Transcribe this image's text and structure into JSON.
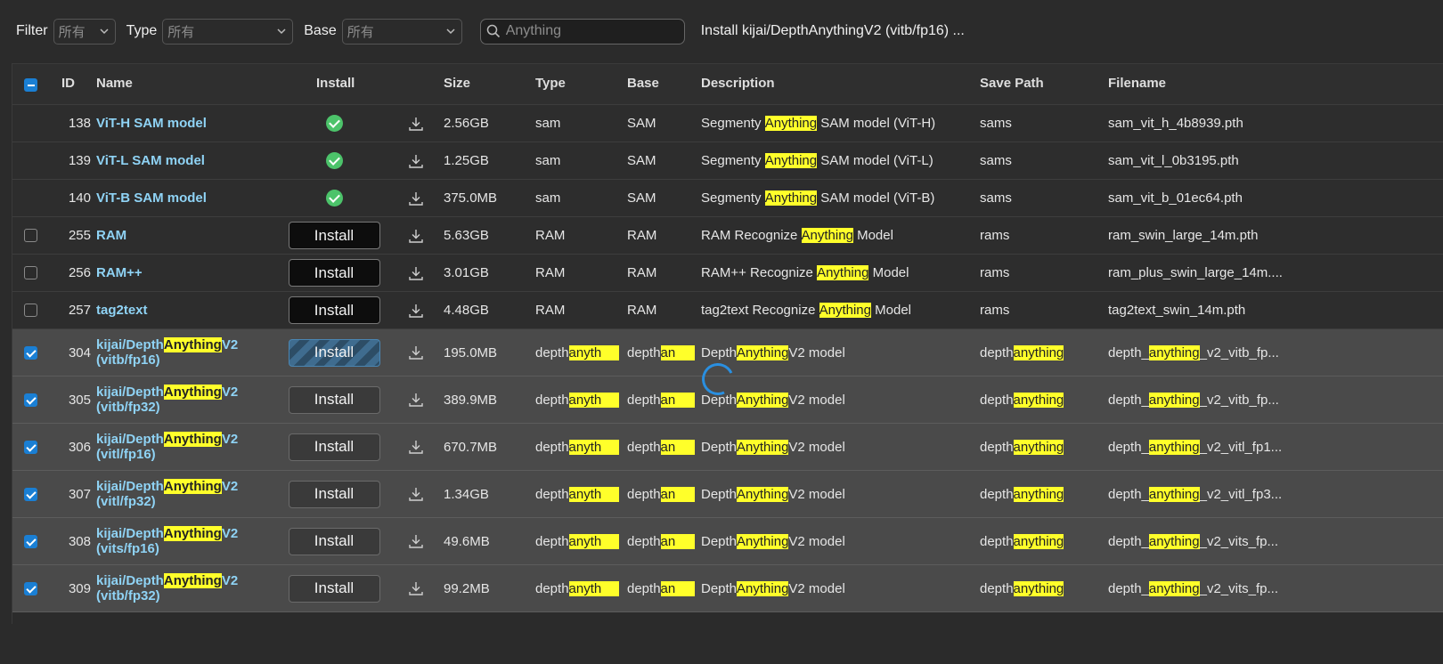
{
  "filterbar": {
    "filter_label": "Filter",
    "filter_value": "所有",
    "type_label": "Type",
    "type_value": "所有",
    "base_label": "Base",
    "base_value": "所有",
    "search_placeholder": "Anything",
    "status": "Install kijai/DepthAnythingV2 (vitb/fp16) ..."
  },
  "table": {
    "headers": {
      "id": "ID",
      "name": "Name",
      "install": "Install",
      "size": "Size",
      "type": "Type",
      "base": "Base",
      "description": "Description",
      "save_path": "Save Path",
      "filename": "Filename"
    },
    "install_label": "Install",
    "rows": [
      {
        "id": "138",
        "name": "ViT-H SAM model",
        "size": "2.56GB",
        "type": "sam",
        "base": "SAM",
        "desc_pre": "Segmenty ",
        "desc_hl": "Anything",
        "desc_post": " SAM model (ViT-H)",
        "path": "sams",
        "file": "sam_vit_h_4b8939.pth"
      },
      {
        "id": "139",
        "name": "ViT-L SAM model",
        "size": "1.25GB",
        "type": "sam",
        "base": "SAM",
        "desc_pre": "Segmenty ",
        "desc_hl": "Anything",
        "desc_post": " SAM model (ViT-L)",
        "path": "sams",
        "file": "sam_vit_l_0b3195.pth"
      },
      {
        "id": "140",
        "name": "ViT-B SAM model",
        "size": "375.0MB",
        "type": "sam",
        "base": "SAM",
        "desc_pre": "Segmenty ",
        "desc_hl": "Anything",
        "desc_post": " SAM model (ViT-B)",
        "path": "sams",
        "file": "sam_vit_b_01ec64.pth"
      },
      {
        "id": "255",
        "name": "RAM",
        "size": "5.63GB",
        "type": "RAM",
        "base": "RAM",
        "desc_pre": "RAM Recognize ",
        "desc_hl": "Anything",
        "desc_post": " Model",
        "path": "rams",
        "file": "ram_swin_large_14m.pth"
      },
      {
        "id": "256",
        "name": "RAM++",
        "size": "3.01GB",
        "type": "RAM",
        "base": "RAM",
        "desc_pre": "RAM++ Recognize ",
        "desc_hl": "Anything",
        "desc_post": " Model",
        "path": "rams",
        "file": "ram_plus_swin_large_14m...."
      },
      {
        "id": "257",
        "name": "tag2text",
        "size": "4.48GB",
        "type": "RAM",
        "base": "RAM",
        "desc_pre": "tag2text Recognize ",
        "desc_hl": "Anything",
        "desc_post": " Model",
        "path": "rams",
        "file": "tag2text_swin_14m.pth"
      },
      {
        "id": "304",
        "name_a": "kijai/Depth",
        "name_hl": "Anything",
        "name_b": "V2",
        "name_c": "(vitb/fp16)",
        "size": "195.0MB",
        "type_a": "depth",
        "type_hl": "anyth",
        "base_a": "depth",
        "base_hl": "an",
        "desc_a": "Depth",
        "desc_hl": "Anything",
        "desc_b": "V2 model",
        "path_a": "depth",
        "path_hl": "anything",
        "file_a": "depth_",
        "file_hl": "anything",
        "file_b": "_v2_vitb_fp..."
      },
      {
        "id": "305",
        "name_a": "kijai/Depth",
        "name_hl": "Anything",
        "name_b": "V2",
        "name_c": "(vitb/fp32)",
        "size": "389.9MB",
        "type_a": "depth",
        "type_hl": "anyth",
        "base_a": "depth",
        "base_hl": "an",
        "desc_a": "Depth",
        "desc_hl": "Anything",
        "desc_b": "V2 model",
        "path_a": "depth",
        "path_hl": "anything",
        "file_a": "depth_",
        "file_hl": "anything",
        "file_b": "_v2_vitb_fp..."
      },
      {
        "id": "306",
        "name_a": "kijai/Depth",
        "name_hl": "Anything",
        "name_b": "V2",
        "name_c": "(vitl/fp16)",
        "size": "670.7MB",
        "type_a": "depth",
        "type_hl": "anyth",
        "base_a": "depth",
        "base_hl": "an",
        "desc_a": "Depth",
        "desc_hl": "Anything",
        "desc_b": "V2 model",
        "path_a": "depth",
        "path_hl": "anything",
        "file_a": "depth_",
        "file_hl": "anything",
        "file_b": "_v2_vitl_fp1..."
      },
      {
        "id": "307",
        "name_a": "kijai/Depth",
        "name_hl": "Anything",
        "name_b": "V2",
        "name_c": "(vitl/fp32)",
        "size": "1.34GB",
        "type_a": "depth",
        "type_hl": "anyth",
        "base_a": "depth",
        "base_hl": "an",
        "desc_a": "Depth",
        "desc_hl": "Anything",
        "desc_b": "V2 model",
        "path_a": "depth",
        "path_hl": "anything",
        "file_a": "depth_",
        "file_hl": "anything",
        "file_b": "_v2_vitl_fp3..."
      },
      {
        "id": "308",
        "name_a": "kijai/Depth",
        "name_hl": "Anything",
        "name_b": "V2",
        "name_c": "(vits/fp16)",
        "size": "49.6MB",
        "type_a": "depth",
        "type_hl": "anyth",
        "base_a": "depth",
        "base_hl": "an",
        "desc_a": "Depth",
        "desc_hl": "Anything",
        "desc_b": "V2 model",
        "path_a": "depth",
        "path_hl": "anything",
        "file_a": "depth_",
        "file_hl": "anything",
        "file_b": "_v2_vits_fp..."
      },
      {
        "id": "309",
        "name_a": "kijai/Depth",
        "name_hl": "Anything",
        "name_b": "V2",
        "name_c": "(vitb/fp32)",
        "size": "99.2MB",
        "type_a": "depth",
        "type_hl": "anyth",
        "base_a": "depth",
        "base_hl": "an",
        "desc_a": "Depth",
        "desc_hl": "Anything",
        "desc_b": "V2 model",
        "path_a": "depth",
        "path_hl": "anything",
        "file_a": "depth_",
        "file_hl": "anything",
        "file_b": "_v2_vits_fp..."
      }
    ]
  },
  "colors": {
    "accent": "#1a7fd4",
    "highlight": "#ffff2a",
    "installed": "#4cc36a",
    "name_link": "#8fd3f5"
  }
}
